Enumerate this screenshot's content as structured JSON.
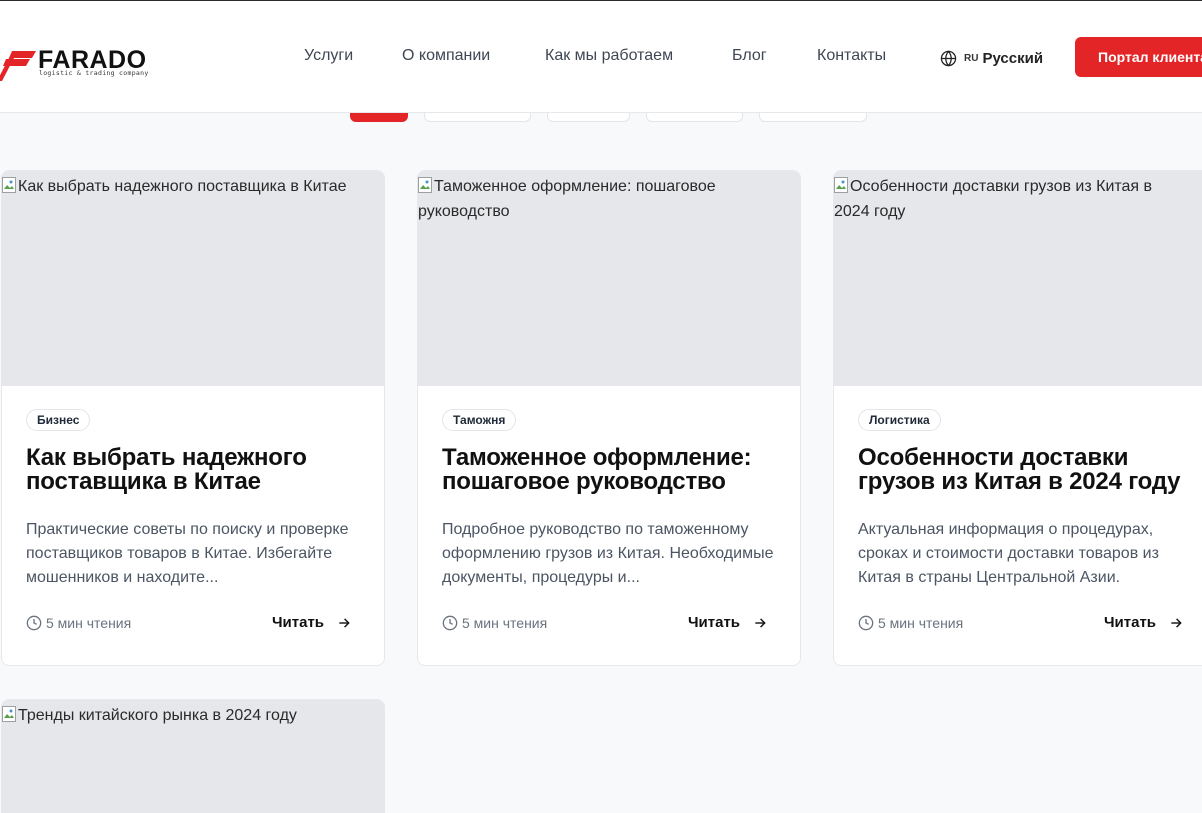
{
  "header": {
    "logo": {
      "name": "FARADO",
      "tagline": "logistic & trading company",
      "icon": "farado-logo-mark"
    },
    "nav": [
      {
        "label": "Услуги"
      },
      {
        "label": "О компании"
      },
      {
        "label": "Как мы работаем"
      },
      {
        "label": "Блог"
      },
      {
        "label": "Контакты"
      }
    ],
    "language": {
      "icon": "globe-icon",
      "code": "RU",
      "label": "Русский"
    },
    "portal_button": "Портал клиента"
  },
  "colors": {
    "accent": "#e42527",
    "image_placeholder": "#e5e7eb",
    "background": "#f8f9fb"
  },
  "articles": [
    {
      "image_alt": "Как выбрать надежного поставщика в Китае",
      "tag": "Бизнес",
      "title": "Как выбрать надежного поставщика в Китае",
      "description": "Практические советы по поиску и проверке поставщиков товаров в Китае. Избегайте мошенников и находите...",
      "read_time": "5 мин чтения",
      "read_label": "Читать"
    },
    {
      "image_alt": "Таможенное оформление: пошаговое руководство",
      "tag": "Таможня",
      "title": "Таможенное оформление: пошаговое руководство",
      "description": "Подробное руководство по таможенному оформлению грузов из Китая. Необходимые документы, процедуры и...",
      "read_time": "5 мин чтения",
      "read_label": "Читать"
    },
    {
      "image_alt": "Особенности доставки грузов из Китая в 2024 году",
      "tag": "Логистика",
      "title": "Особенности доставки грузов из Китая в 2024 году",
      "description": "Актуальная информация о процедурах, сроках и стоимости доставки товаров из Китая в страны Центральной Азии.",
      "read_time": "5 мин чтения",
      "read_label": "Читать"
    },
    {
      "image_alt": "Тренды китайского рынка в 2024 году"
    }
  ]
}
